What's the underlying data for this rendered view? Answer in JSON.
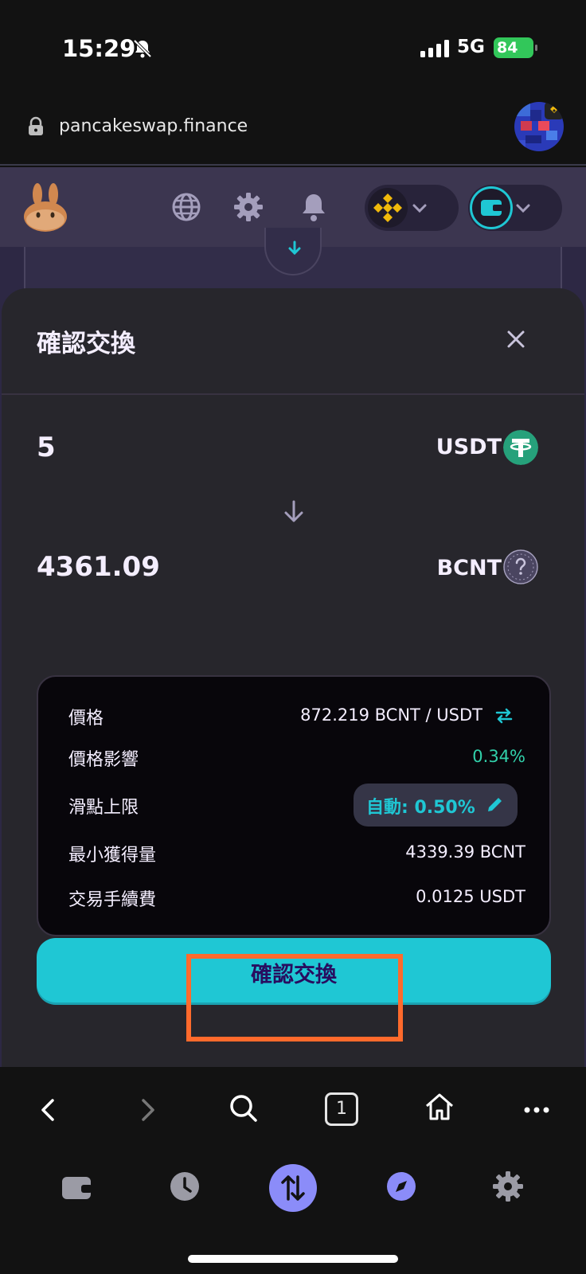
{
  "status": {
    "time": "15:29",
    "network": "5G",
    "battery": "84"
  },
  "browser": {
    "url": "pancakeswap.finance",
    "tabs_count": "1"
  },
  "modal": {
    "title": "確認交換",
    "input": {
      "amount": "5",
      "symbol": "USDT"
    },
    "output": {
      "amount": "4361.09",
      "symbol": "BCNT"
    },
    "details": {
      "price_label": "價格",
      "price_value": "872.219 BCNT / USDT",
      "impact_label": "價格影響",
      "impact_value": "0.34%",
      "slippage_label": "滑點上限",
      "slippage_value": "自動: 0.50%",
      "min_received_label": "最小獲得量",
      "min_received_value": "4339.39 BCNT",
      "fee_label": "交易手續費",
      "fee_value": "0.0125 USDT"
    },
    "confirm_label": "確認交換"
  },
  "colors": {
    "primary": "#1fc7d4",
    "success": "#31d0aa",
    "highlight": "#ff6a2c",
    "usdt": "#26a17b",
    "nav_active": "#8b8cf9"
  }
}
